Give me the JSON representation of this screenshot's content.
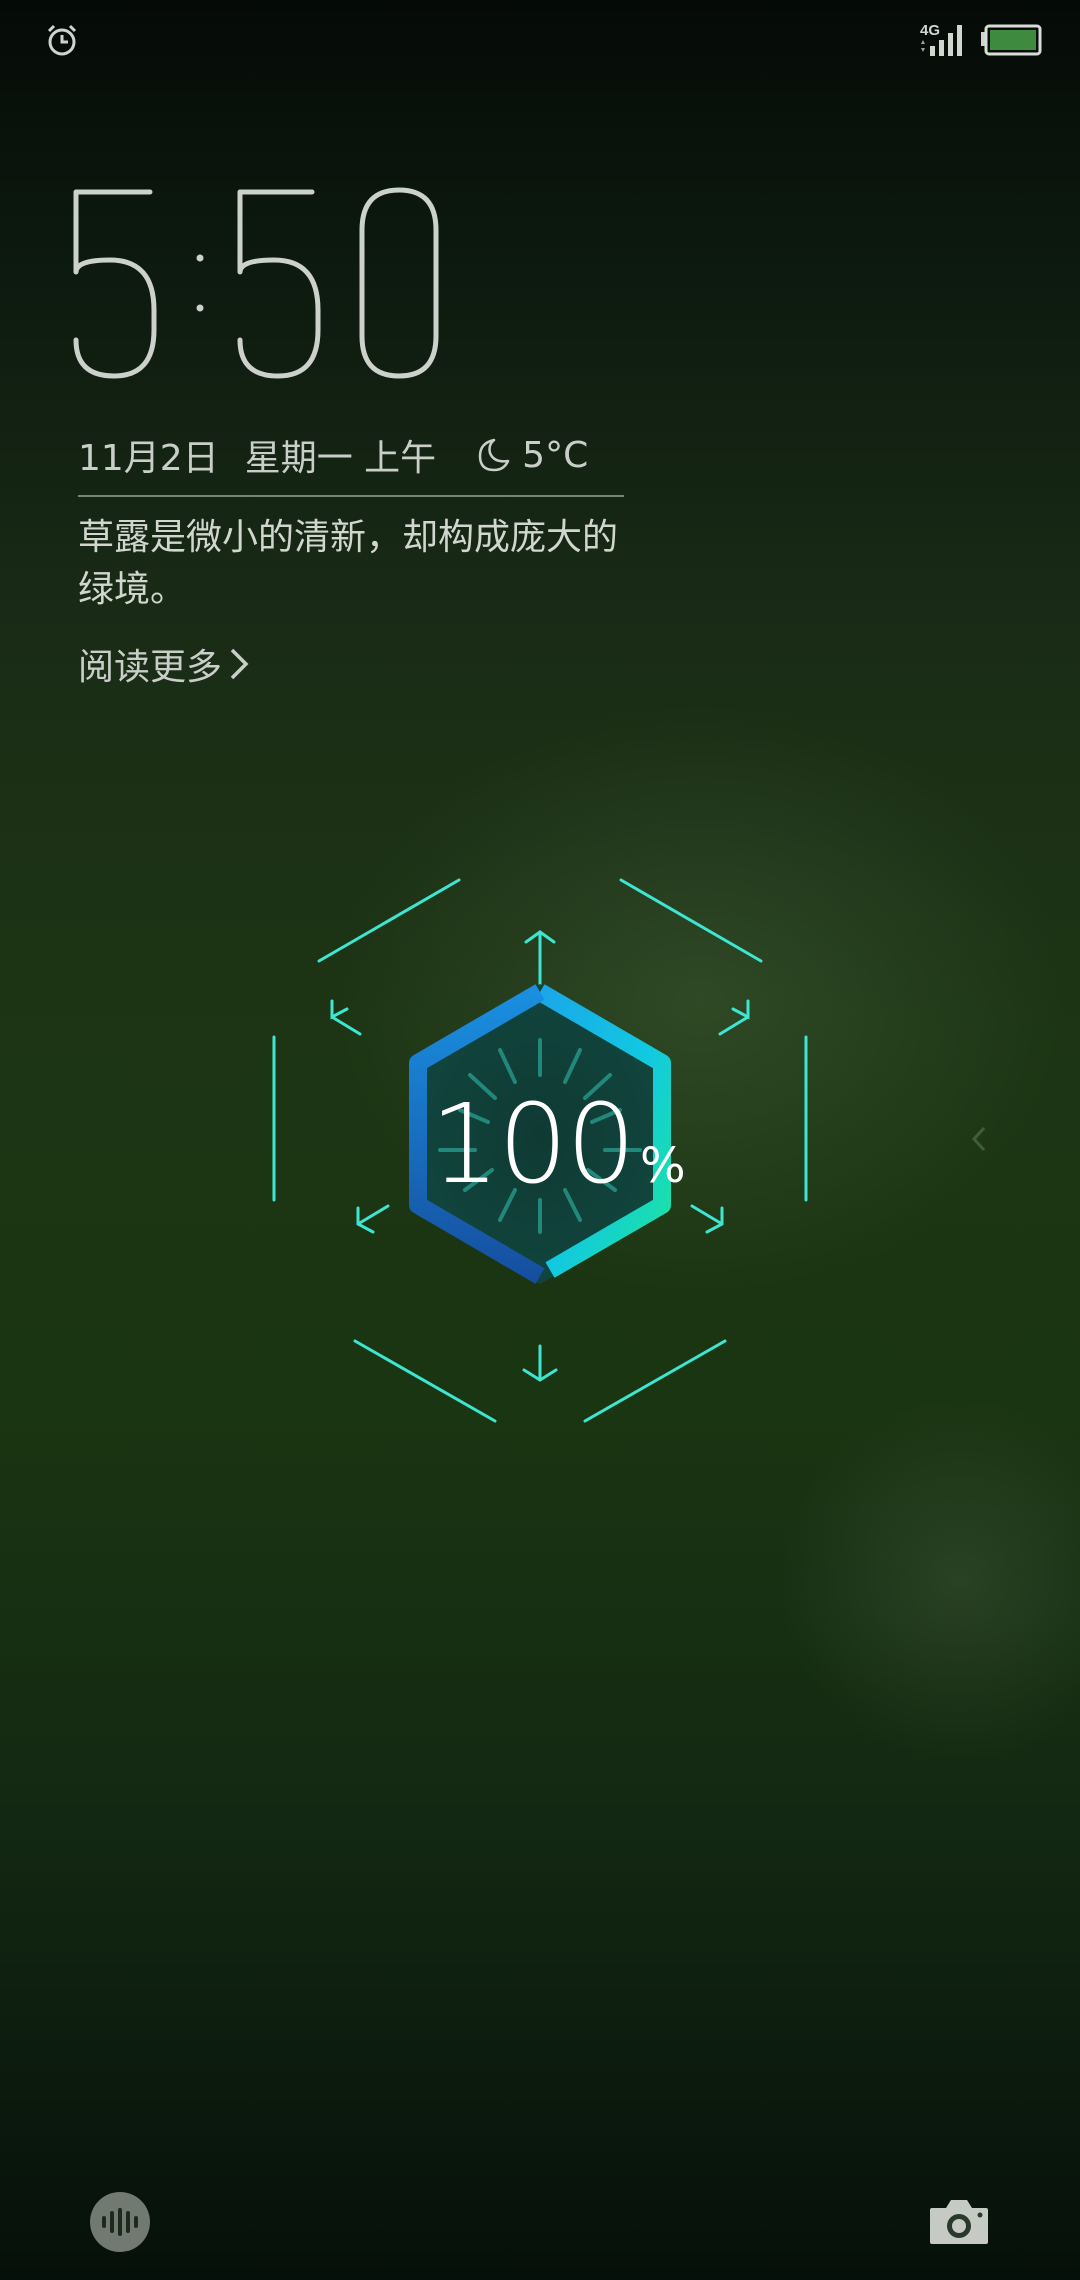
{
  "status_bar": {
    "network_type": "4G",
    "battery_level_percent": 100,
    "icons": [
      "alarm-icon",
      "signal-icon",
      "battery-icon"
    ]
  },
  "clock": {
    "hour": "5",
    "minute": "50"
  },
  "date": {
    "date": "11月2日",
    "weekday_period": "星期一 上午",
    "weather_icon": "moon-icon",
    "temperature": "5°C"
  },
  "quote": {
    "text": "草露是微小的清新，却构成庞大的绿境。",
    "read_more_label": "阅读更多"
  },
  "charging": {
    "percent_value": "100",
    "percent_sign": "%",
    "colors": {
      "accent": "#3ee6d2",
      "ring_start": "#1aa7e8",
      "ring_end": "#1de4a0"
    }
  },
  "shortcuts": {
    "left": "voice-assistant-icon",
    "right": "camera-icon"
  }
}
